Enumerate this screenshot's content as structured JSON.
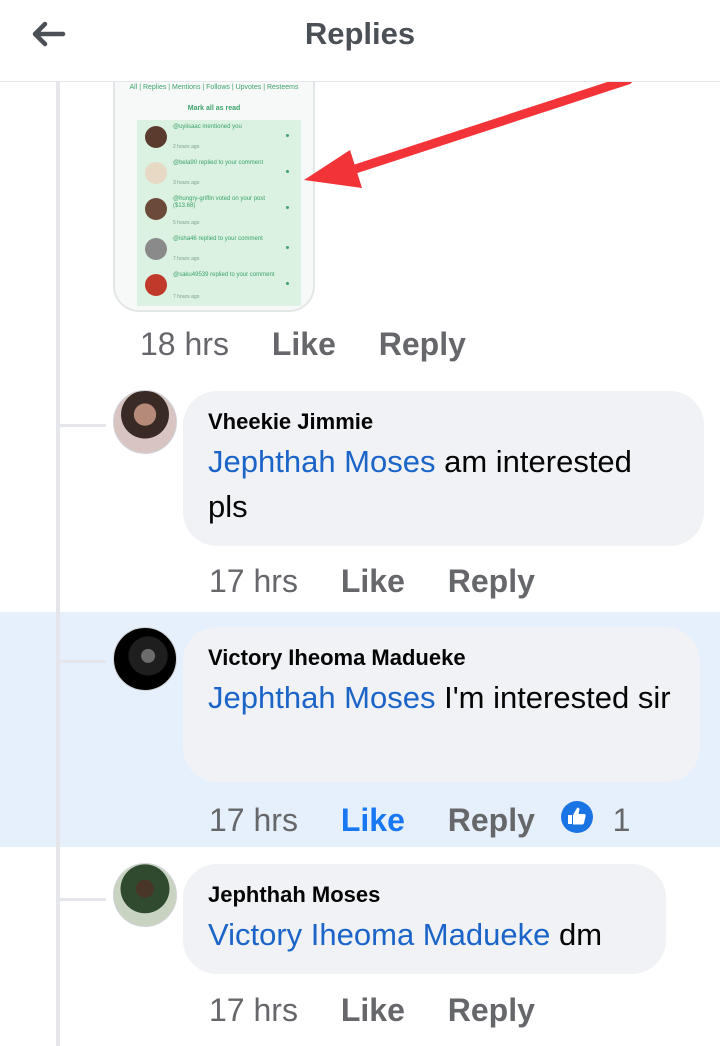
{
  "header": {
    "title": "Replies",
    "back_icon": "back-arrow-icon"
  },
  "screenshot_preview": {
    "tabs": "All | Replies | Mentions | Follows | Upvotes | Resteems",
    "mark_all": "Mark all as read",
    "notifications": [
      {
        "text": "@uyiisaac mentioned you",
        "time": "2 hours ago"
      },
      {
        "text": "@bela90 replied to your comment",
        "time": "3 hours ago"
      },
      {
        "text": "@hungry-griffin voted on your post ($13.68)",
        "time": "5 hours ago"
      },
      {
        "text": "@isha46 replied to your comment",
        "time": "7 hours ago"
      },
      {
        "text": "@saku49539 replied to your comment",
        "time": "7 hours ago"
      }
    ]
  },
  "parent": {
    "time": "18 hrs",
    "like": "Like",
    "reply": "Reply"
  },
  "replies": [
    {
      "author": "Vheekie Jimmie",
      "mention": "Jephthah Moses",
      "text": " am interested pls",
      "time": "17 hrs",
      "like": "Like",
      "reply": "Reply"
    },
    {
      "author": "Victory Iheoma Madueke",
      "mention": "Jephthah Moses",
      "text": " I'm interested sir",
      "time": "17 hrs",
      "like": "Like",
      "reply": "Reply",
      "reaction_count": "1",
      "reaction_icon": "like-thumb-icon",
      "liked_color": "#1877f2"
    },
    {
      "author": "Jephthah Moses",
      "mention": "Victory Iheoma Madueke",
      "text": " dm",
      "time": "17 hrs",
      "like": "Like",
      "reply": "Reply"
    }
  ],
  "colors": {
    "mention": "#1b64c8",
    "highlight": "#e6f0fc",
    "bubble": "#f0f2f5",
    "arrow": "#f23438"
  }
}
